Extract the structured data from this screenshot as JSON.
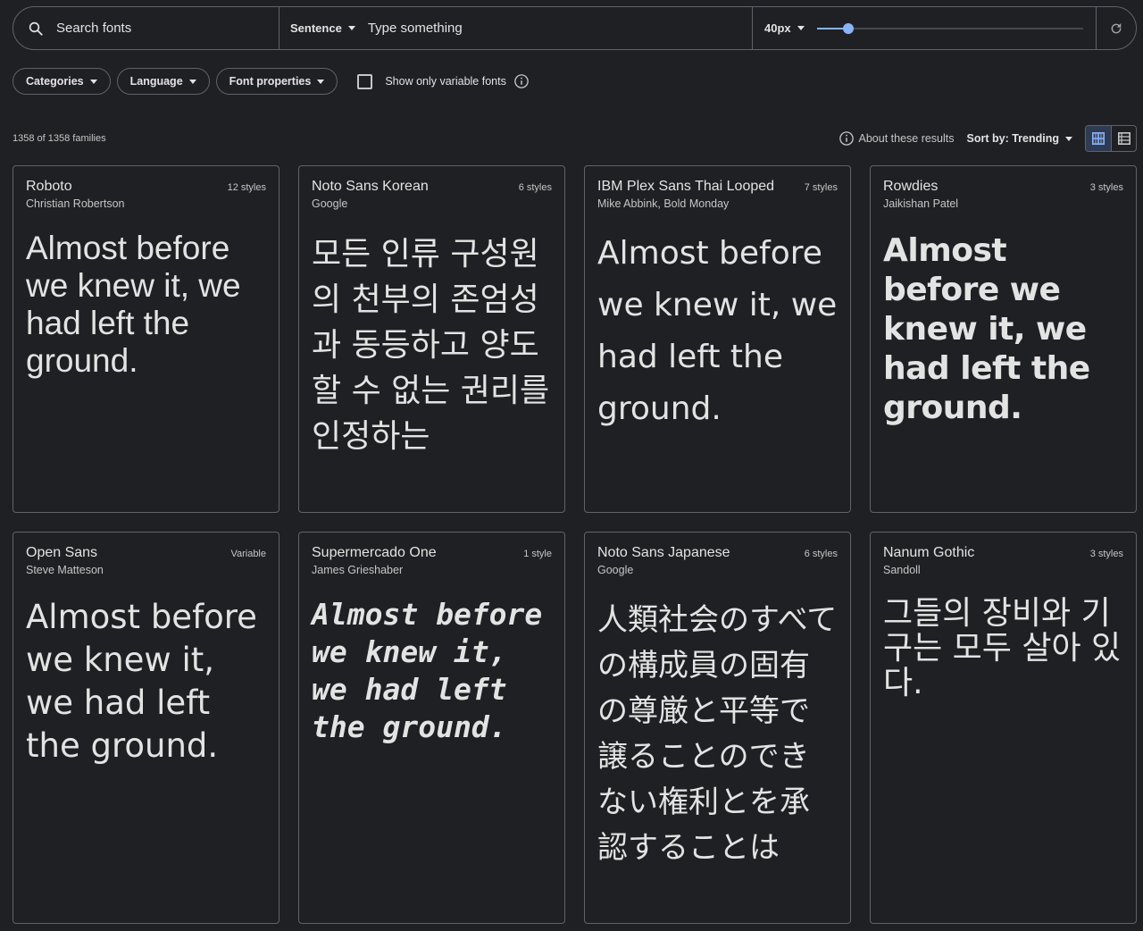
{
  "topbar": {
    "search_placeholder": "Search fonts",
    "sentence_mode": "Sentence",
    "type_placeholder": "Type something",
    "size_value": "40px",
    "size_slider_fraction": 0.12
  },
  "filters": {
    "chips": [
      "Categories",
      "Language",
      "Font properties"
    ],
    "variable_label": "Show only variable fonts"
  },
  "results": {
    "count": "1358 of 1358 families",
    "about": "About these results",
    "sort": "Sort by: Trending"
  },
  "cards": [
    {
      "family": "Roboto",
      "styles": "12 styles",
      "designer": "Christian Robertson",
      "sample": "Almost before we knew it, we had left the ground."
    },
    {
      "family": "Noto Sans Korean",
      "styles": "6 styles",
      "designer": "Google",
      "sample": "모든 인류 구성원의 천부의 존엄성과 동등하고 양도할 수 없는 권리를 인정하는"
    },
    {
      "family": "IBM Plex Sans Thai Looped",
      "styles": "7 styles",
      "designer": "Mike Abbink, Bold Monday",
      "sample": "Almost before we knew it, we had left the ground."
    },
    {
      "family": "Rowdies",
      "styles": "3 styles",
      "designer": "Jaikishan Patel",
      "sample": "Almost before we knew it, we had left the ground."
    },
    {
      "family": "Open Sans",
      "styles": "Variable",
      "designer": "Steve Matteson",
      "sample": "Almost before we knew it, we had left the ground."
    },
    {
      "family": "Supermercado One",
      "styles": "1 style",
      "designer": "James Grieshaber",
      "sample": "Almost before we knew it, we had left the ground."
    },
    {
      "family": "Noto Sans Japanese",
      "styles": "6 styles",
      "designer": "Google",
      "sample": "人類社会のすべての構成員の固有の尊厳と平等で譲ることのできない権利とを承認することは"
    },
    {
      "family": "Nanum Gothic",
      "styles": "3 styles",
      "designer": "Sandoll",
      "sample": "그들의 장비와 기구는 모두 살아 있다."
    }
  ],
  "colors": {
    "accent": "#8ab4f8",
    "border": "#5f6368",
    "background": "#1f2023"
  }
}
